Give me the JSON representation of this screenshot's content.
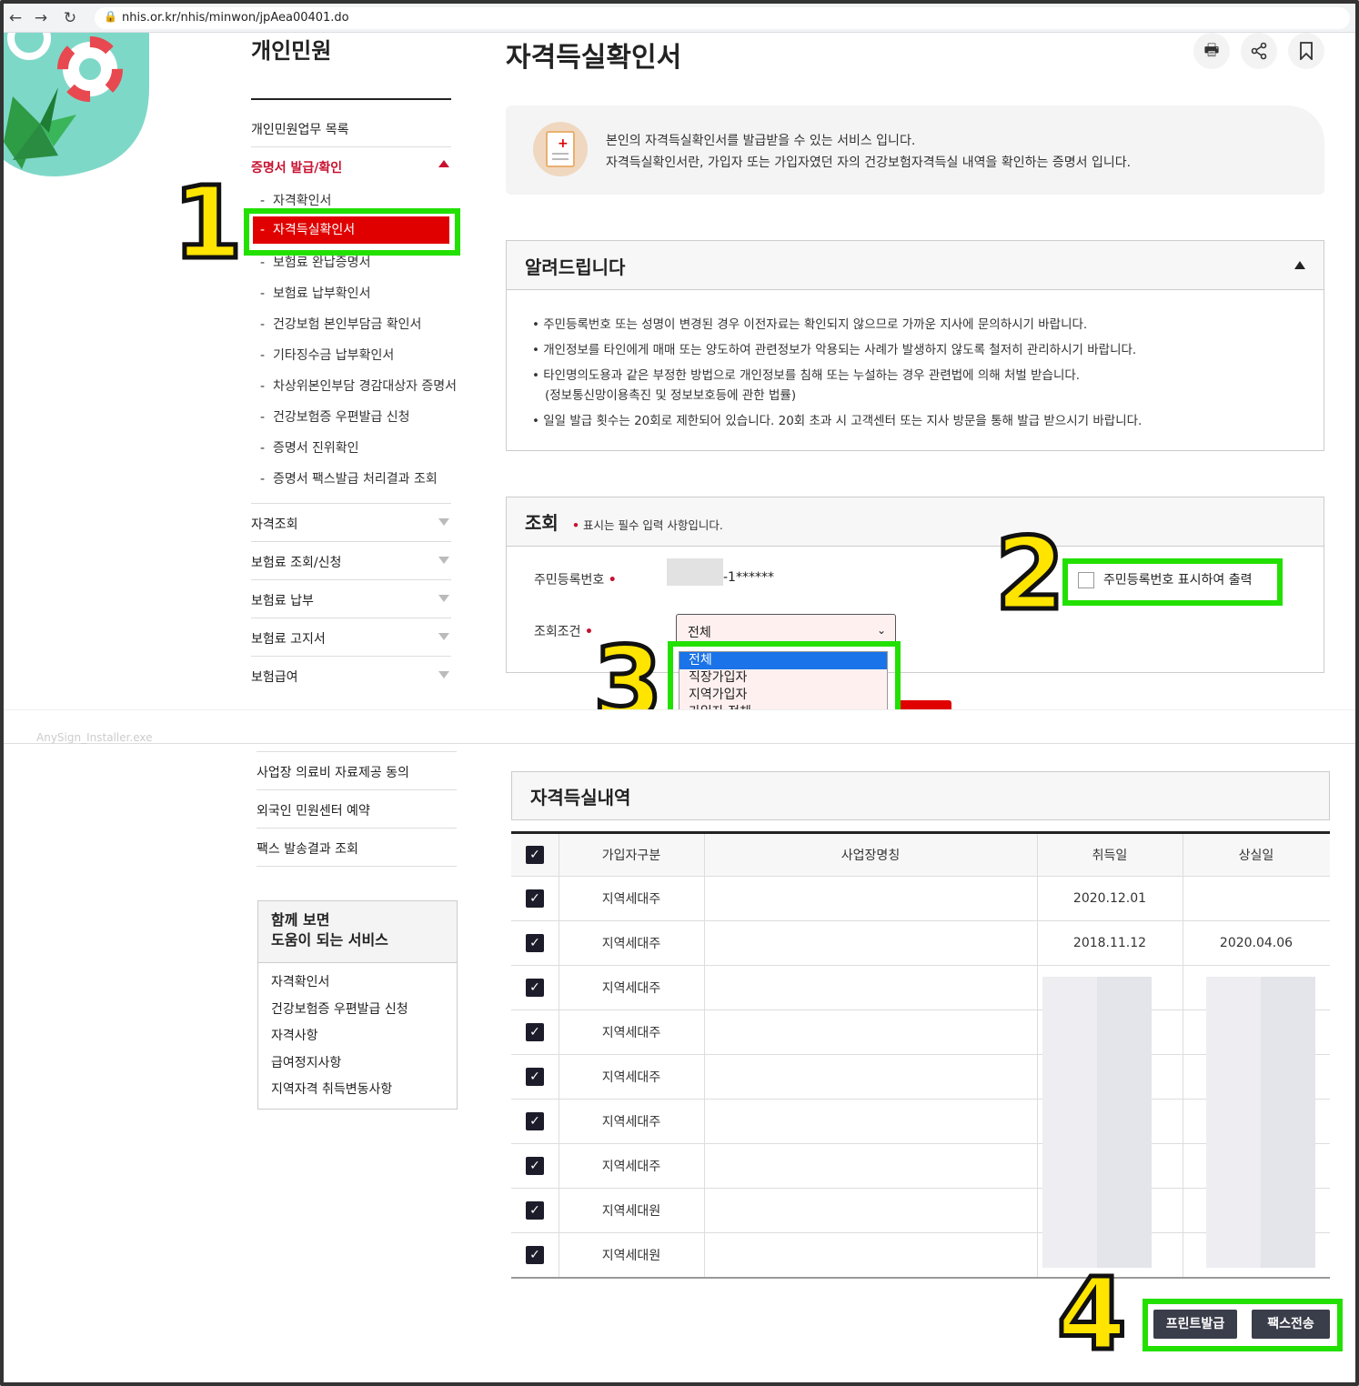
{
  "browser": {
    "url": "nhis.or.kr/nhis/minwon/jpAea00401.do",
    "back_icon": "←",
    "forward_icon": "→",
    "reload_icon": "↻",
    "lock_icon": "🔒"
  },
  "sidebar": {
    "title": "개인민원",
    "list_link": "개인민원업무 목록",
    "section_active": "증명서 발급/확인",
    "sub_items": [
      "자격확인서",
      "자격득실확인서",
      "보험료 완납증명서",
      "보험료 납부확인서",
      "건강보험 본인부담금 확인서",
      "기타징수금 납부확인서",
      "차상위본인부담 경감대상자 증명서",
      "건강보험증 우편발급 신청",
      "증명서 진위확인",
      "증명서 팩스발급 처리결과 조회"
    ],
    "sections": [
      "자격조회",
      "보험료 조회/신청",
      "보험료 납부",
      "보험료 고지서",
      "보험급여"
    ],
    "lower_items": [
      "사업장 의료비 자료제공 동의",
      "외국인 민원센터 예약",
      "팩스 발송결과 조회"
    ],
    "related": {
      "title_line1": "함께 보면",
      "title_line2": "도움이 되는 서비스",
      "items": [
        "자격확인서",
        "건강보험증 우편발급 신청",
        "자격사항",
        "급여정지사항",
        "지역자격 취득변동사항"
      ]
    }
  },
  "annotations": {
    "n1": "1",
    "n2": "2",
    "n3": "3",
    "n4": "4"
  },
  "main": {
    "title": "자격득실확인서",
    "tools": {
      "print_icon": "🖶",
      "share_icon": "⋖",
      "bookmark_icon": "🔖"
    },
    "intro_line1": "본인의 자격득실확인서를 발급받을 수 있는 서비스 입니다.",
    "intro_line2": "자격득실확인서란, 가입자 또는 가입자였던 자의 건강보험자격득실 내역을 확인하는 증명서 입니다.",
    "notice": {
      "title": "알려드립니다",
      "items": [
        "• 주민등록번호 또는 성명이 변경된 경우 이전자료는 확인되지 않으므로 가까운 지사에 문의하시기 바랍니다.",
        "• 개인정보를 타인에게 매매 또는 양도하여 관련정보가 악용되는 사례가 발생하지 않도록 철저히 관리하시기 바랍니다.",
        "• 타인명의도용과 같은 부정한 방법으로 개인정보를 침해 또는 누설하는 경우 관련법에 의해 처벌 받습니다.",
        "(정보통신망이용촉진 및 정보보호등에 관한 법률)",
        "• 일일 발급 횟수는 20회로 제한되어 있습니다. 20회 초과 시 고객센터 또는 지사 방문을 통해 발급 받으시기 바랍니다."
      ]
    },
    "query": {
      "title": "조회",
      "req_mark": "•",
      "note": "표시는 필수 입력 사항입니다.",
      "rrn_label": "주민등록번호",
      "rrn_suffix": "-1******",
      "show_rrn_label": "주민등록번호 표시하여 출력",
      "cond_label": "조회조건",
      "select_value": "전체",
      "options": [
        "전체",
        "직장가입자",
        "지역가입자",
        "가입자 전체"
      ]
    },
    "download_bar": "AnySign_Installer.exe",
    "history": {
      "title": "자격득실내역",
      "columns": [
        "가입자구분",
        "사업장명칭",
        "취득일",
        "상실일"
      ],
      "rows": [
        {
          "type": "지역세대주",
          "workplace": "",
          "acquired": "2020.12.01",
          "lost": ""
        },
        {
          "type": "지역세대주",
          "workplace": "",
          "acquired": "2018.11.12",
          "lost": "2020.04.06"
        },
        {
          "type": "지역세대주",
          "workplace": "",
          "acquired": "",
          "lost": ""
        },
        {
          "type": "지역세대주",
          "workplace": "",
          "acquired": "",
          "lost": ""
        },
        {
          "type": "지역세대주",
          "workplace": "",
          "acquired": "",
          "lost": ""
        },
        {
          "type": "지역세대주",
          "workplace": "",
          "acquired": "",
          "lost": ""
        },
        {
          "type": "지역세대주",
          "workplace": "",
          "acquired": "",
          "lost": ""
        },
        {
          "type": "지역세대원",
          "workplace": "",
          "acquired": "",
          "lost": ""
        },
        {
          "type": "지역세대원",
          "workplace": "",
          "acquired": "",
          "lost": ""
        }
      ]
    },
    "print_button": "프린트발급",
    "fax_button": "팩스전송",
    "colors": {
      "accent_red": "#c8102e",
      "highlight_green": "#22e000",
      "number_yellow": "#ffe400"
    }
  }
}
